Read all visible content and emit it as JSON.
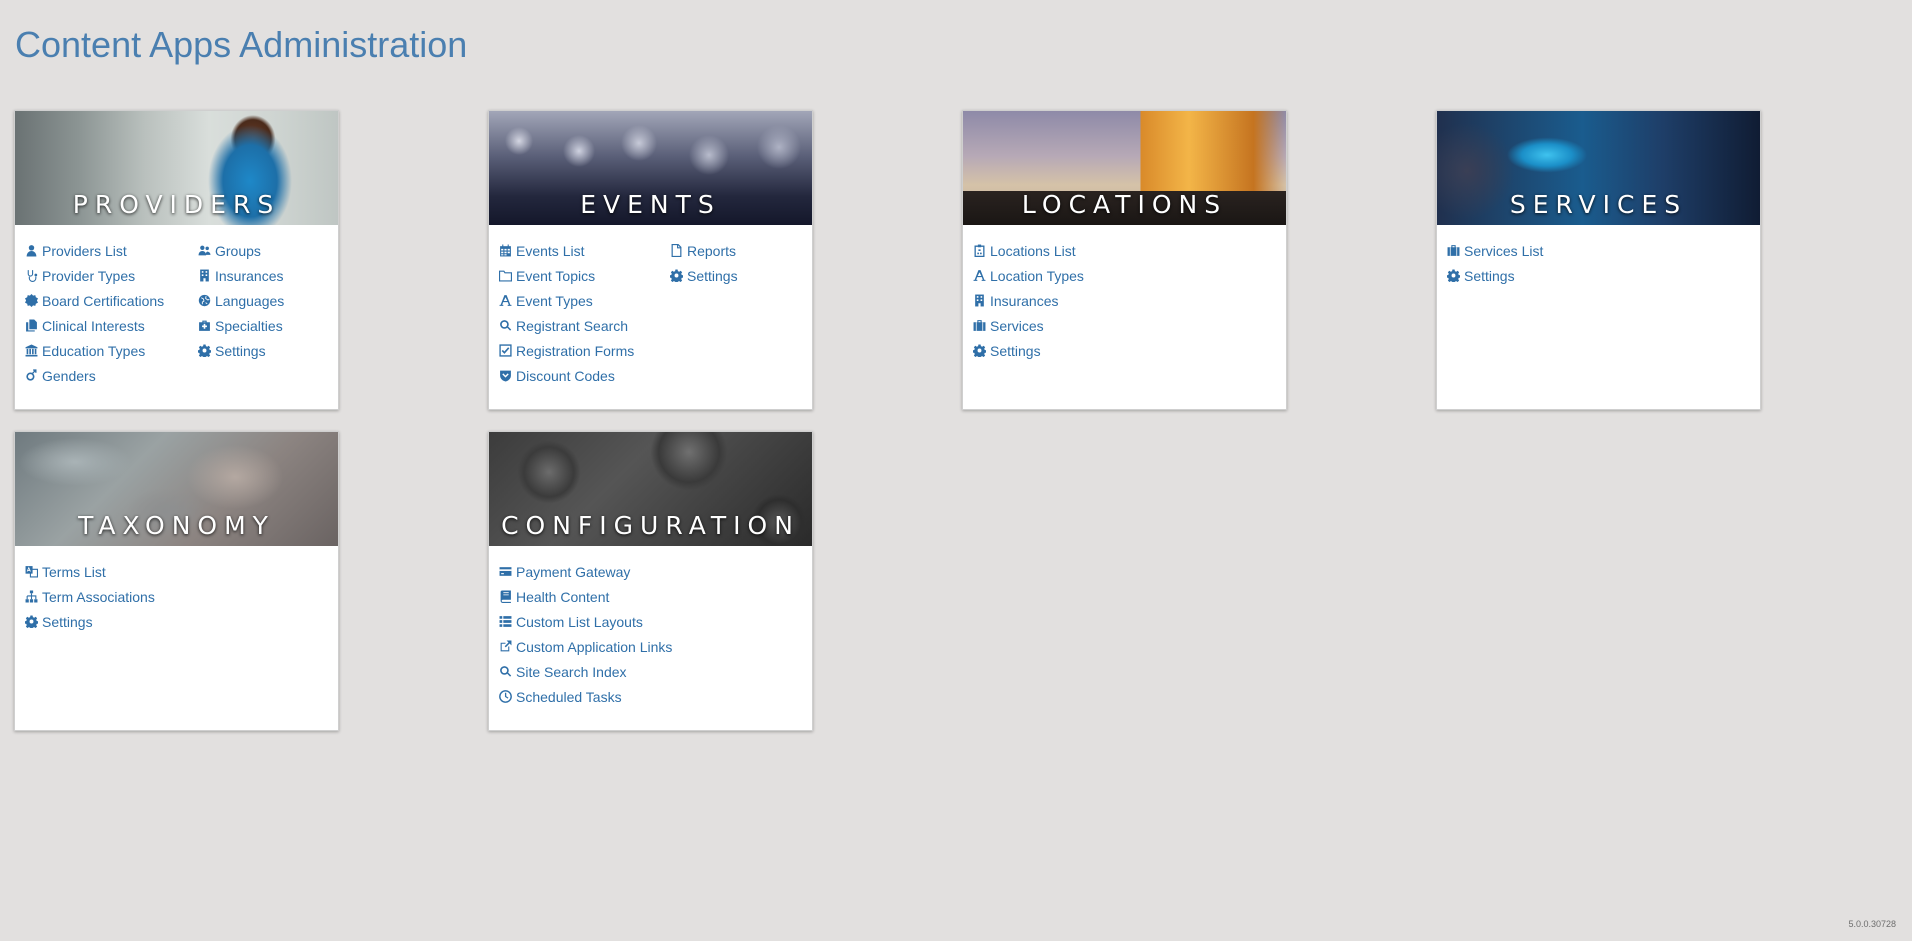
{
  "page": {
    "title": "Content Apps Administration",
    "version": "5.0.0.30728"
  },
  "cards": {
    "providers": {
      "title": "PROVIDERS",
      "col1": [
        {
          "label": "Providers List",
          "icon": "user-md-icon"
        },
        {
          "label": "Provider Types",
          "icon": "stethoscope-icon"
        },
        {
          "label": "Board Certifications",
          "icon": "certificate-icon"
        },
        {
          "label": "Clinical Interests",
          "icon": "files-icon"
        },
        {
          "label": "Education Types",
          "icon": "institution-icon"
        },
        {
          "label": "Genders",
          "icon": "genderless-icon"
        }
      ],
      "col2": [
        {
          "label": "Groups",
          "icon": "users-icon"
        },
        {
          "label": "Insurances",
          "icon": "building-icon"
        },
        {
          "label": "Languages",
          "icon": "globe-icon"
        },
        {
          "label": "Specialties",
          "icon": "medkit-icon"
        },
        {
          "label": "Settings",
          "icon": "gear-icon"
        }
      ]
    },
    "events": {
      "title": "EVENTS",
      "col1": [
        {
          "label": "Events List",
          "icon": "calendar-icon"
        },
        {
          "label": "Event Topics",
          "icon": "folder-icon"
        },
        {
          "label": "Event Types",
          "icon": "font-icon"
        },
        {
          "label": "Registrant Search",
          "icon": "search-icon"
        },
        {
          "label": "Registration Forms",
          "icon": "check-square-icon"
        },
        {
          "label": "Discount Codes",
          "icon": "shield-icon"
        }
      ],
      "col2": [
        {
          "label": "Reports",
          "icon": "file-icon"
        },
        {
          "label": "Settings",
          "icon": "gear-icon"
        }
      ]
    },
    "locations": {
      "title": "LOCATIONS",
      "col1": [
        {
          "label": "Locations List",
          "icon": "hospital-icon"
        },
        {
          "label": "Location Types",
          "icon": "font-icon"
        },
        {
          "label": "Insurances",
          "icon": "building-icon"
        },
        {
          "label": "Services",
          "icon": "briefcase-icon"
        },
        {
          "label": "Settings",
          "icon": "gear-icon"
        }
      ]
    },
    "services": {
      "title": "SERVICES",
      "col1": [
        {
          "label": "Services List",
          "icon": "briefcase-icon"
        },
        {
          "label": "Settings",
          "icon": "gear-icon"
        }
      ]
    },
    "taxonomy": {
      "title": "TAXONOMY",
      "col1": [
        {
          "label": "Terms List",
          "icon": "language-icon"
        },
        {
          "label": "Term Associations",
          "icon": "sitemap-icon"
        },
        {
          "label": "Settings",
          "icon": "gear-icon"
        }
      ]
    },
    "configuration": {
      "title": "CONFIGURATION",
      "col1": [
        {
          "label": "Payment Gateway",
          "icon": "credit-card-icon"
        },
        {
          "label": "Health Content",
          "icon": "book-icon"
        },
        {
          "label": "Custom List Layouts",
          "icon": "list-icon"
        },
        {
          "label": "Custom Application Links",
          "icon": "external-link-icon"
        },
        {
          "label": "Site Search Index",
          "icon": "search-icon"
        },
        {
          "label": "Scheduled Tasks",
          "icon": "clock-icon"
        }
      ]
    }
  },
  "colors": {
    "link": "#2f6fa8",
    "title": "#4a7fb0",
    "background": "#e2e0df"
  }
}
